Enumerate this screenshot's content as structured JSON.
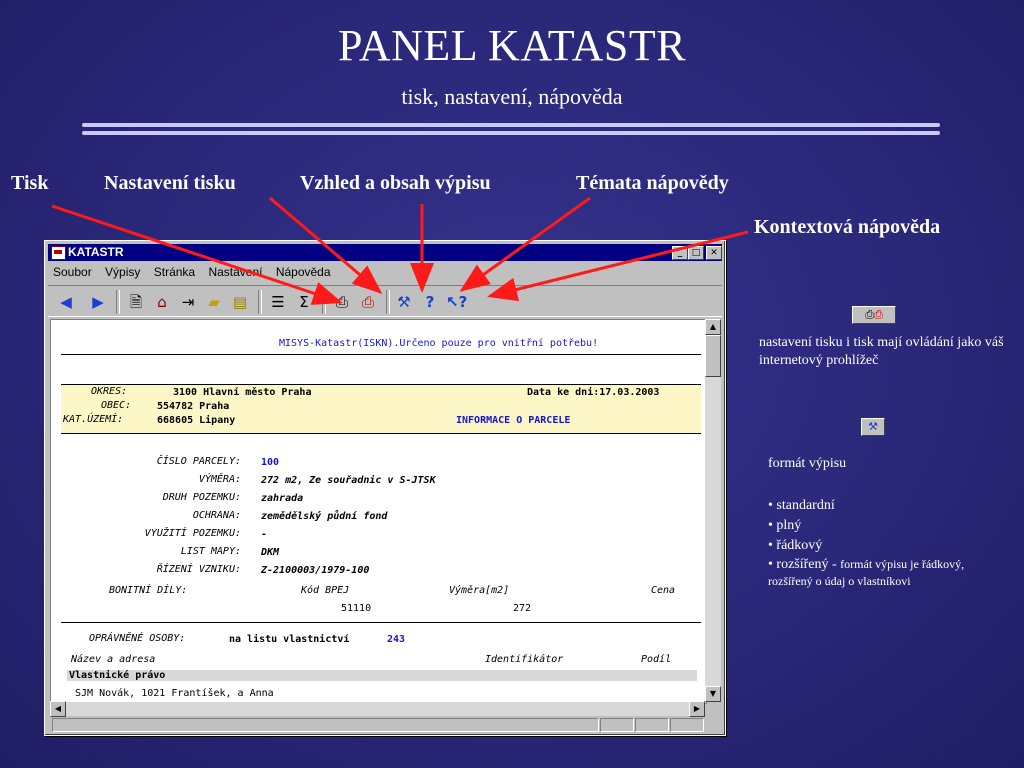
{
  "slide": {
    "title": "PANEL KATASTR",
    "subtitle": "tisk, nastavení, nápověda"
  },
  "callouts": {
    "tisk": "Tisk",
    "nastaveni_tisku": "Nastavení tisku",
    "vzhled": "Vzhled a obsah výpisu",
    "temata": "Témata nápovědy",
    "kontext": "Kontextová nápověda"
  },
  "window": {
    "title": "KATASTR",
    "menu": [
      "Soubor",
      "Výpisy",
      "Stránka",
      "Nastavení",
      "Nápověda"
    ],
    "toolbar_icons": [
      "back-arrow-icon",
      "forward-arrow-icon",
      "document-icon",
      "home-icon",
      "export-icon",
      "open-folder-icon",
      "paste-icon",
      "list-icon",
      "sum-icon",
      "print-icon",
      "print-settings-icon",
      "tools-icon",
      "help-icon",
      "context-help-icon"
    ]
  },
  "document": {
    "header_line": "MISYS-Katastr(ISKN).Určeno pouze pro vnitřní potřebu!",
    "okres_label": "OKRES:",
    "okres_value": "3100 Hlavní město Praha",
    "date_label": "Data ke dni:17.03.2003",
    "obec_label": "OBEC:",
    "obec_value": "554782 Praha",
    "ku_label": "KAT.ÚZEMÍ:",
    "ku_value": "668605 Lipany",
    "info_title": "INFORMACE O PARCELE",
    "fields": [
      {
        "label": "ČÍSLO PARCELY:",
        "value": "100"
      },
      {
        "label": "VÝMĚRA:",
        "value": "272 m2, Ze souřadnic v S-JTSK"
      },
      {
        "label": "DRUH POZEMKU:",
        "value": "zahrada"
      },
      {
        "label": "OCHRANA:",
        "value": "zemědělský půdní fond"
      },
      {
        "label": "VYUŽITÍ POZEMKU:",
        "value": "-"
      },
      {
        "label": "LIST MAPY:",
        "value": "DKM"
      },
      {
        "label": "ŘÍZENÍ VZNIKU:",
        "value": "Z-2100003/1979-100"
      }
    ],
    "bonitni_label": "BONITNÍ DÍLY:",
    "bonitni_headers": [
      "Kód BPEJ",
      "Výměra[m2]",
      "Cena"
    ],
    "bonitni_row": [
      "51110",
      "272"
    ],
    "opravnene_label": "OPRÁVNĚNÉ OSOBY:",
    "opravnene_value": "na listu vlastnictví",
    "opravnene_lv": "243",
    "owner_headers": [
      "Název a adresa",
      "Identifikátor",
      "Podíl"
    ],
    "section_title": "Vlastnické právo",
    "cut_row": "SJM Novák, 1021 Frantíšek, a Anna"
  },
  "side_panel": {
    "print_desc": "nastavení tisku i tisk mají ovládání jako váš internetový prohlížeč",
    "format_title": "formát výpisu",
    "bullets": [
      "standardní",
      "plný",
      "řádkový"
    ],
    "last_bullet_bold": "rozšířený -",
    "last_bullet_rest": "formát výpisu je řádkový, rozšířený o údaj o vlastníkovi"
  }
}
